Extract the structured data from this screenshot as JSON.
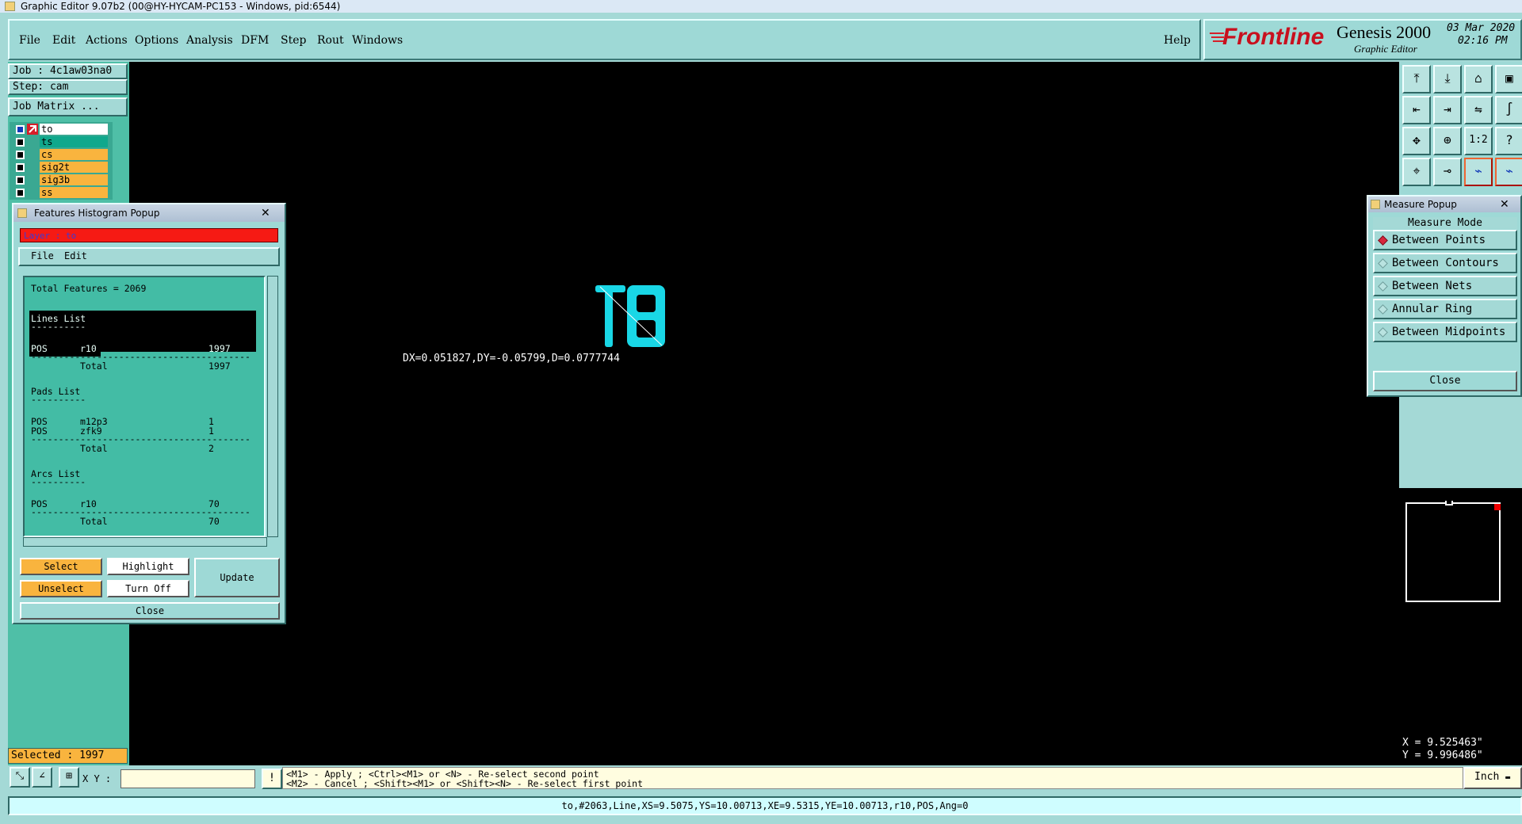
{
  "window": {
    "title": "Graphic Editor 9.07b2 (00@HY-HYCAM-PC153 - Windows, pid:6544)"
  },
  "menu": {
    "items": [
      "File",
      "Edit",
      "Actions",
      "Options",
      "Analysis",
      "DFM",
      "Step",
      "Rout",
      "Windows"
    ],
    "help": "Help"
  },
  "brand": {
    "logo": "Frontline",
    "product": "Genesis 2000",
    "subtitle": "Graphic Editor",
    "date": "03 Mar 2020",
    "time": "02:16 PM"
  },
  "left": {
    "job": "Job : 4c1aw03na0",
    "step": "Step: cam",
    "job_matrix": "Job Matrix ...",
    "layers": [
      {
        "name": "to",
        "state": "work"
      },
      {
        "name": "ts",
        "state": "affected"
      },
      {
        "name": "cs",
        "state": "normal"
      },
      {
        "name": "sig2t",
        "state": "normal"
      },
      {
        "name": "sig3b",
        "state": "normal"
      },
      {
        "name": "ss",
        "state": "normal"
      }
    ],
    "selected": "Selected : 1997"
  },
  "histogram": {
    "title": "Features Histogram Popup",
    "layer": "Layer :  to",
    "menu_file": "File",
    "menu_edit": "Edit",
    "total_features": "Total Features = 2069",
    "lines_title": "Lines List",
    "sep": "----------",
    "lines_row": {
      "pol": "POS",
      "sym": "r10",
      "count": "1997"
    },
    "lines_total": "Total",
    "lines_total_val": "1997",
    "pads_title": "Pads List",
    "pads_rows": [
      {
        "pol": "POS",
        "sym": "m12p3",
        "count": "1"
      },
      {
        "pol": "POS",
        "sym": "zfk9",
        "count": "1"
      }
    ],
    "pads_total": "Total",
    "pads_total_val": "2",
    "arcs_title": "Arcs List",
    "arcs_row": {
      "pol": "POS",
      "sym": "r10",
      "count": "70"
    },
    "arcs_total": "Total",
    "arcs_total_val": "70",
    "longsep": "----------------------------------------",
    "btn_select": "Select",
    "btn_highlight": "Highlight",
    "btn_unselect": "Unselect",
    "btn_turnoff": "Turn Off",
    "btn_update": "Update",
    "btn_close": "Close"
  },
  "canvas": {
    "measure_text": "DX=0.051827,DY=-0.05799,D=0.0777744",
    "accent": "#19d7e6"
  },
  "measure": {
    "title": "Measure Popup",
    "mode_label": "Measure Mode",
    "options": [
      "Between Points",
      "Between Contours",
      "Between Nets",
      "Annular Ring",
      "Between Midpoints"
    ],
    "selected": 0,
    "close": "Close"
  },
  "toolbar_icons": [
    "home-icon",
    "save-icon",
    "house-icon",
    "window-icon",
    "prev-icon",
    "next-icon",
    "mirror-icon",
    "swap-icon",
    "zoom-fit-icon",
    "zoom-home-icon",
    "scale-1to2-icon",
    "help-icon",
    "snap-icon",
    "pin-icon",
    "net-icon",
    "net2-icon"
  ],
  "toolbar_text": {
    "ratio": "1:2",
    "question": "?"
  },
  "coords": {
    "x": "X = 9.525463\"",
    "y": "Y = 9.996486\""
  },
  "status": {
    "xy_label": "X Y :",
    "xy_value": "",
    "hint1": "<M1> - Apply  ; <Ctrl><M1> or <N> - Re-select second point",
    "hint2": "<M2> - Cancel ; <Shift><M1> or <Shift><N> - Re-select first point",
    "unit": "Inch",
    "info": "to,#2063,Line,XS=9.5075,YS=10.00713,XE=9.5315,YE=10.00713,r10,POS,Ang=0"
  }
}
